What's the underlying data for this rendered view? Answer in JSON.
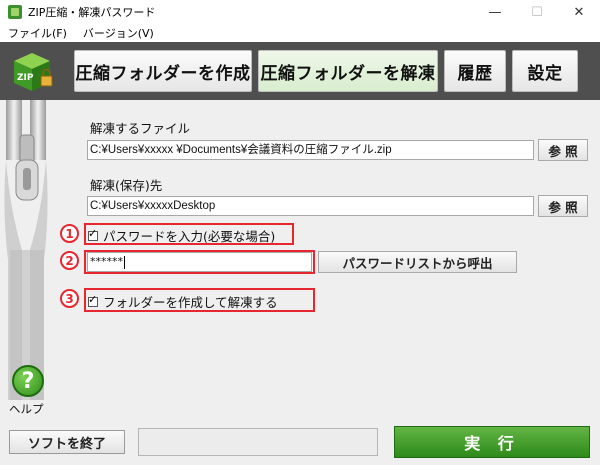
{
  "window": {
    "title": "ZIP圧縮・解凍パスワード",
    "minimize": "—",
    "maximize": "☐",
    "close": "✕"
  },
  "menu": {
    "file": "ファイル(F)",
    "version": "バージョン(V)"
  },
  "toolbar": {
    "logo_text": "ZIP",
    "compress": "圧縮フォルダーを作成",
    "extract": "圧縮フォルダーを解凍",
    "history": "履歴",
    "settings": "設定"
  },
  "form": {
    "source_label": "解凍するファイル",
    "source_value": "C:¥Users¥xxxxx ¥Documents¥会議資料の圧縮ファイル.zip",
    "browse1": "参 照",
    "dest_label": "解凍(保存)先",
    "dest_value": "C:¥Users¥xxxxxDesktop",
    "browse2": "参 照",
    "password_check_label": "パスワードを入力(必要な場合)",
    "password_value": "******",
    "password_list_button": "パスワードリストから呼出",
    "create_folder_label": "フォルダーを作成して解凍する"
  },
  "markers": {
    "m1": "1",
    "m2": "2",
    "m3": "3"
  },
  "footer": {
    "help_symbol": "?",
    "help_label": "ヘルプ",
    "exit_button": "ソフトを終了",
    "execute_button": "実 行"
  },
  "colors": {
    "toolbar_bg": "#4f4f4f",
    "accent_green": "#2d8a1a",
    "highlight_red": "#e8262f"
  }
}
